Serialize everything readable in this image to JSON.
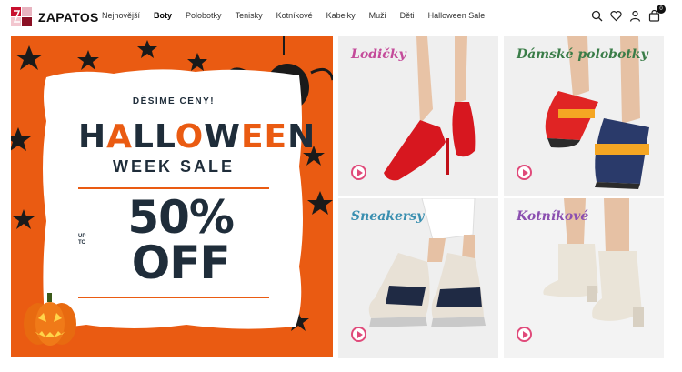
{
  "brand": {
    "name": "ZAPATOS"
  },
  "nav": {
    "items": [
      "Nejnovější",
      "Boty",
      "Polobotky",
      "Tenisky",
      "Kotníkové",
      "Kabelky",
      "Muži",
      "Děti",
      "Halloween Sale"
    ],
    "active": "Boty"
  },
  "header_icons": {
    "search": "search-icon",
    "wishlist": "heart-icon",
    "account": "user-icon",
    "cart": "bag-icon",
    "cart_count": "0"
  },
  "hero": {
    "tagline": "DĚSÍME CENY!",
    "title_parts": [
      "H",
      "A",
      "LL",
      "O",
      "W",
      "EE",
      "N"
    ],
    "subtitle": "WEEK SALE",
    "upto": "UP TO",
    "discount": "50% OFF",
    "bg_color": "#ea5b12"
  },
  "tiles": [
    {
      "label": "Lodičky"
    },
    {
      "label": "Dámské polobotky"
    },
    {
      "label": "Sneakersy"
    },
    {
      "label": "Kotníkové"
    }
  ]
}
